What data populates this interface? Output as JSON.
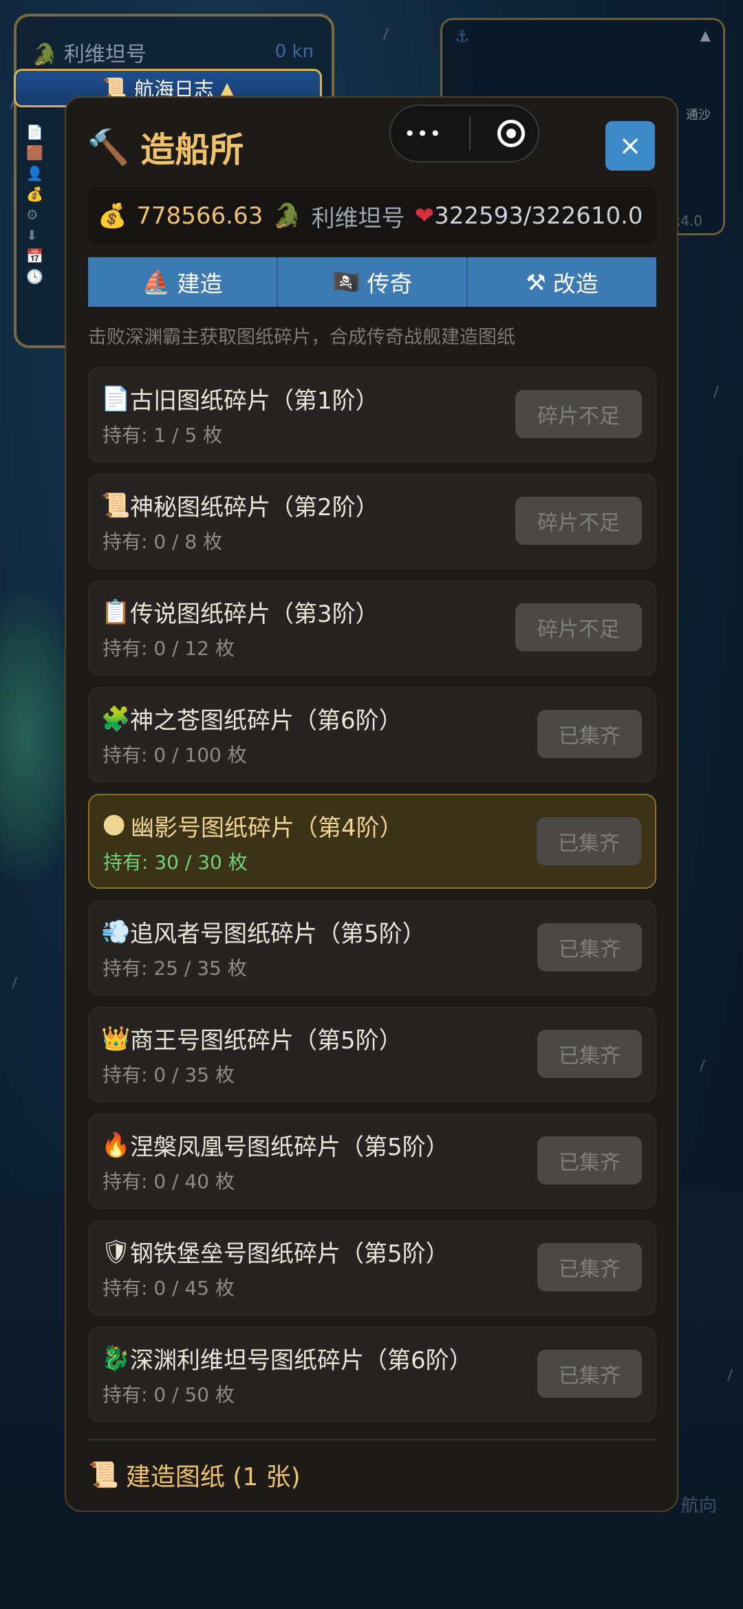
{
  "background": {
    "ship_name": "利维坦号",
    "speed": "0 kn",
    "log_button": "航海日志",
    "nav_hint": "航向",
    "minimap_zoom": "x4.0",
    "minimap_label": "通沙"
  },
  "modal": {
    "title": "造船所",
    "close_label": "×",
    "stats": {
      "gold": "778566.63",
      "ship": "利维坦号",
      "hp": "322593/322610.0"
    },
    "tabs": [
      {
        "icon": "⛵",
        "label": "建造"
      },
      {
        "icon": "🏴‍☠️",
        "label": "传奇"
      },
      {
        "icon": "⚒",
        "label": "改造"
      }
    ],
    "hint": "击败深渊霸主获取图纸碎片，合成传奇战舰建造图纸",
    "items": [
      {
        "icon": "📄",
        "name": "古旧图纸碎片（第1阶）",
        "count": "持有: 1 / 5 枚",
        "action": "碎片不足"
      },
      {
        "icon": "📜",
        "name": "神秘图纸碎片（第2阶）",
        "count": "持有: 0 / 8 枚",
        "action": "碎片不足"
      },
      {
        "icon": "📋",
        "name": "传说图纸碎片（第3阶）",
        "count": "持有: 0 / 12 枚",
        "action": "碎片不足"
      },
      {
        "icon": "🧩",
        "name": "神之苍图纸碎片（第6阶）",
        "count": "持有: 0 / 100 枚",
        "action": "已集齐"
      },
      {
        "icon": "🌑",
        "name": "幽影号图纸碎片（第4阶）",
        "count": "持有: 30 / 30 枚",
        "action": "已集齐"
      },
      {
        "icon": "💨",
        "name": "追风者号图纸碎片（第5阶）",
        "count": "持有: 25 / 35 枚",
        "action": "已集齐"
      },
      {
        "icon": "👑",
        "name": "商王号图纸碎片（第5阶）",
        "count": "持有: 0 / 35 枚",
        "action": "已集齐"
      },
      {
        "icon": "🔥",
        "name": "涅槃凤凰号图纸碎片（第5阶）",
        "count": "持有: 0 / 40 枚",
        "action": "已集齐"
      },
      {
        "icon": "🛡",
        "name": "钢铁堡垒号图纸碎片（第5阶）",
        "count": "持有: 0 / 45 枚",
        "action": "已集齐"
      },
      {
        "icon": "🐉",
        "name": "深渊利维坦号图纸碎片（第6阶）",
        "count": "持有: 0 / 50 枚",
        "action": "已集齐"
      }
    ],
    "footer": "建造图纸 (1 张)"
  }
}
